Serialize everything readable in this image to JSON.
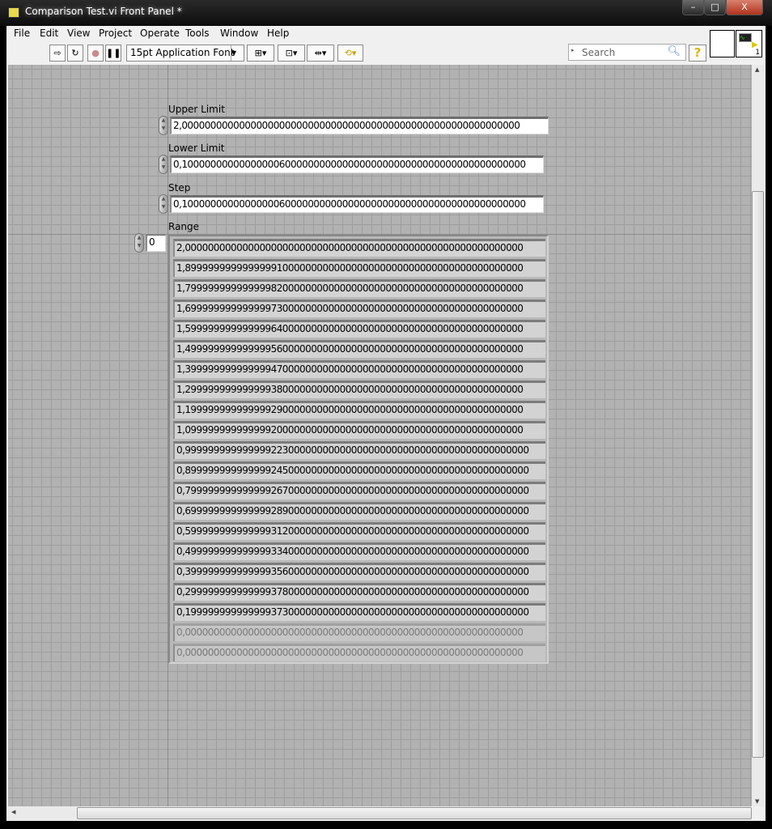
{
  "window": {
    "title": "Comparison Test.vi Front Panel *",
    "minimize": "–",
    "maximize": "□",
    "close": "X"
  },
  "menu": [
    "File",
    "Edit",
    "View",
    "Project",
    "Operate",
    "Tools",
    "Window",
    "Help"
  ],
  "toolbar": {
    "font": "15pt Application Font",
    "search_placeholder": "Search",
    "connector_count": "1"
  },
  "controls": {
    "upper_limit": {
      "label": "Upper Limit",
      "value": "2,00000000000000000000000000000000000000000000000000000000000"
    },
    "lower_limit": {
      "label": "Lower Limit",
      "value": "0,100000000000000006000000000000000000000000000000000000000000"
    },
    "step": {
      "label": "Step",
      "value": "0,100000000000000006000000000000000000000000000000000000000000"
    }
  },
  "range": {
    "label": "Range",
    "index": "0",
    "values": [
      "2,00000000000000000000000000000000000000000000000000000000000",
      "1,89999999999999991000000000000000000000000000000000000000000",
      "1,79999999999999982000000000000000000000000000000000000000000",
      "1,69999999999999973000000000000000000000000000000000000000000",
      "1,59999999999999964000000000000000000000000000000000000000000",
      "1,49999999999999956000000000000000000000000000000000000000000",
      "1,39999999999999947000000000000000000000000000000000000000000",
      "1,29999999999999938000000000000000000000000000000000000000000",
      "1,19999999999999929000000000000000000000000000000000000000000",
      "1,09999999999999920000000000000000000000000000000000000000000",
      "0,999999999999999223000000000000000000000000000000000000000000",
      "0,899999999999999245000000000000000000000000000000000000000000",
      "0,799999999999999267000000000000000000000000000000000000000000",
      "0,699999999999999289000000000000000000000000000000000000000000",
      "0,599999999999999312000000000000000000000000000000000000000000",
      "0,499999999999999334000000000000000000000000000000000000000000",
      "0,399999999999999356000000000000000000000000000000000000000000",
      "0,299999999999999378000000000000000000000000000000000000000000",
      "0,199999999999999373000000000000000000000000000000000000000000",
      "0,00000000000000000000000000000000000000000000000000000000000",
      "0,00000000000000000000000000000000000000000000000000000000000"
    ],
    "filled_count": 19
  }
}
